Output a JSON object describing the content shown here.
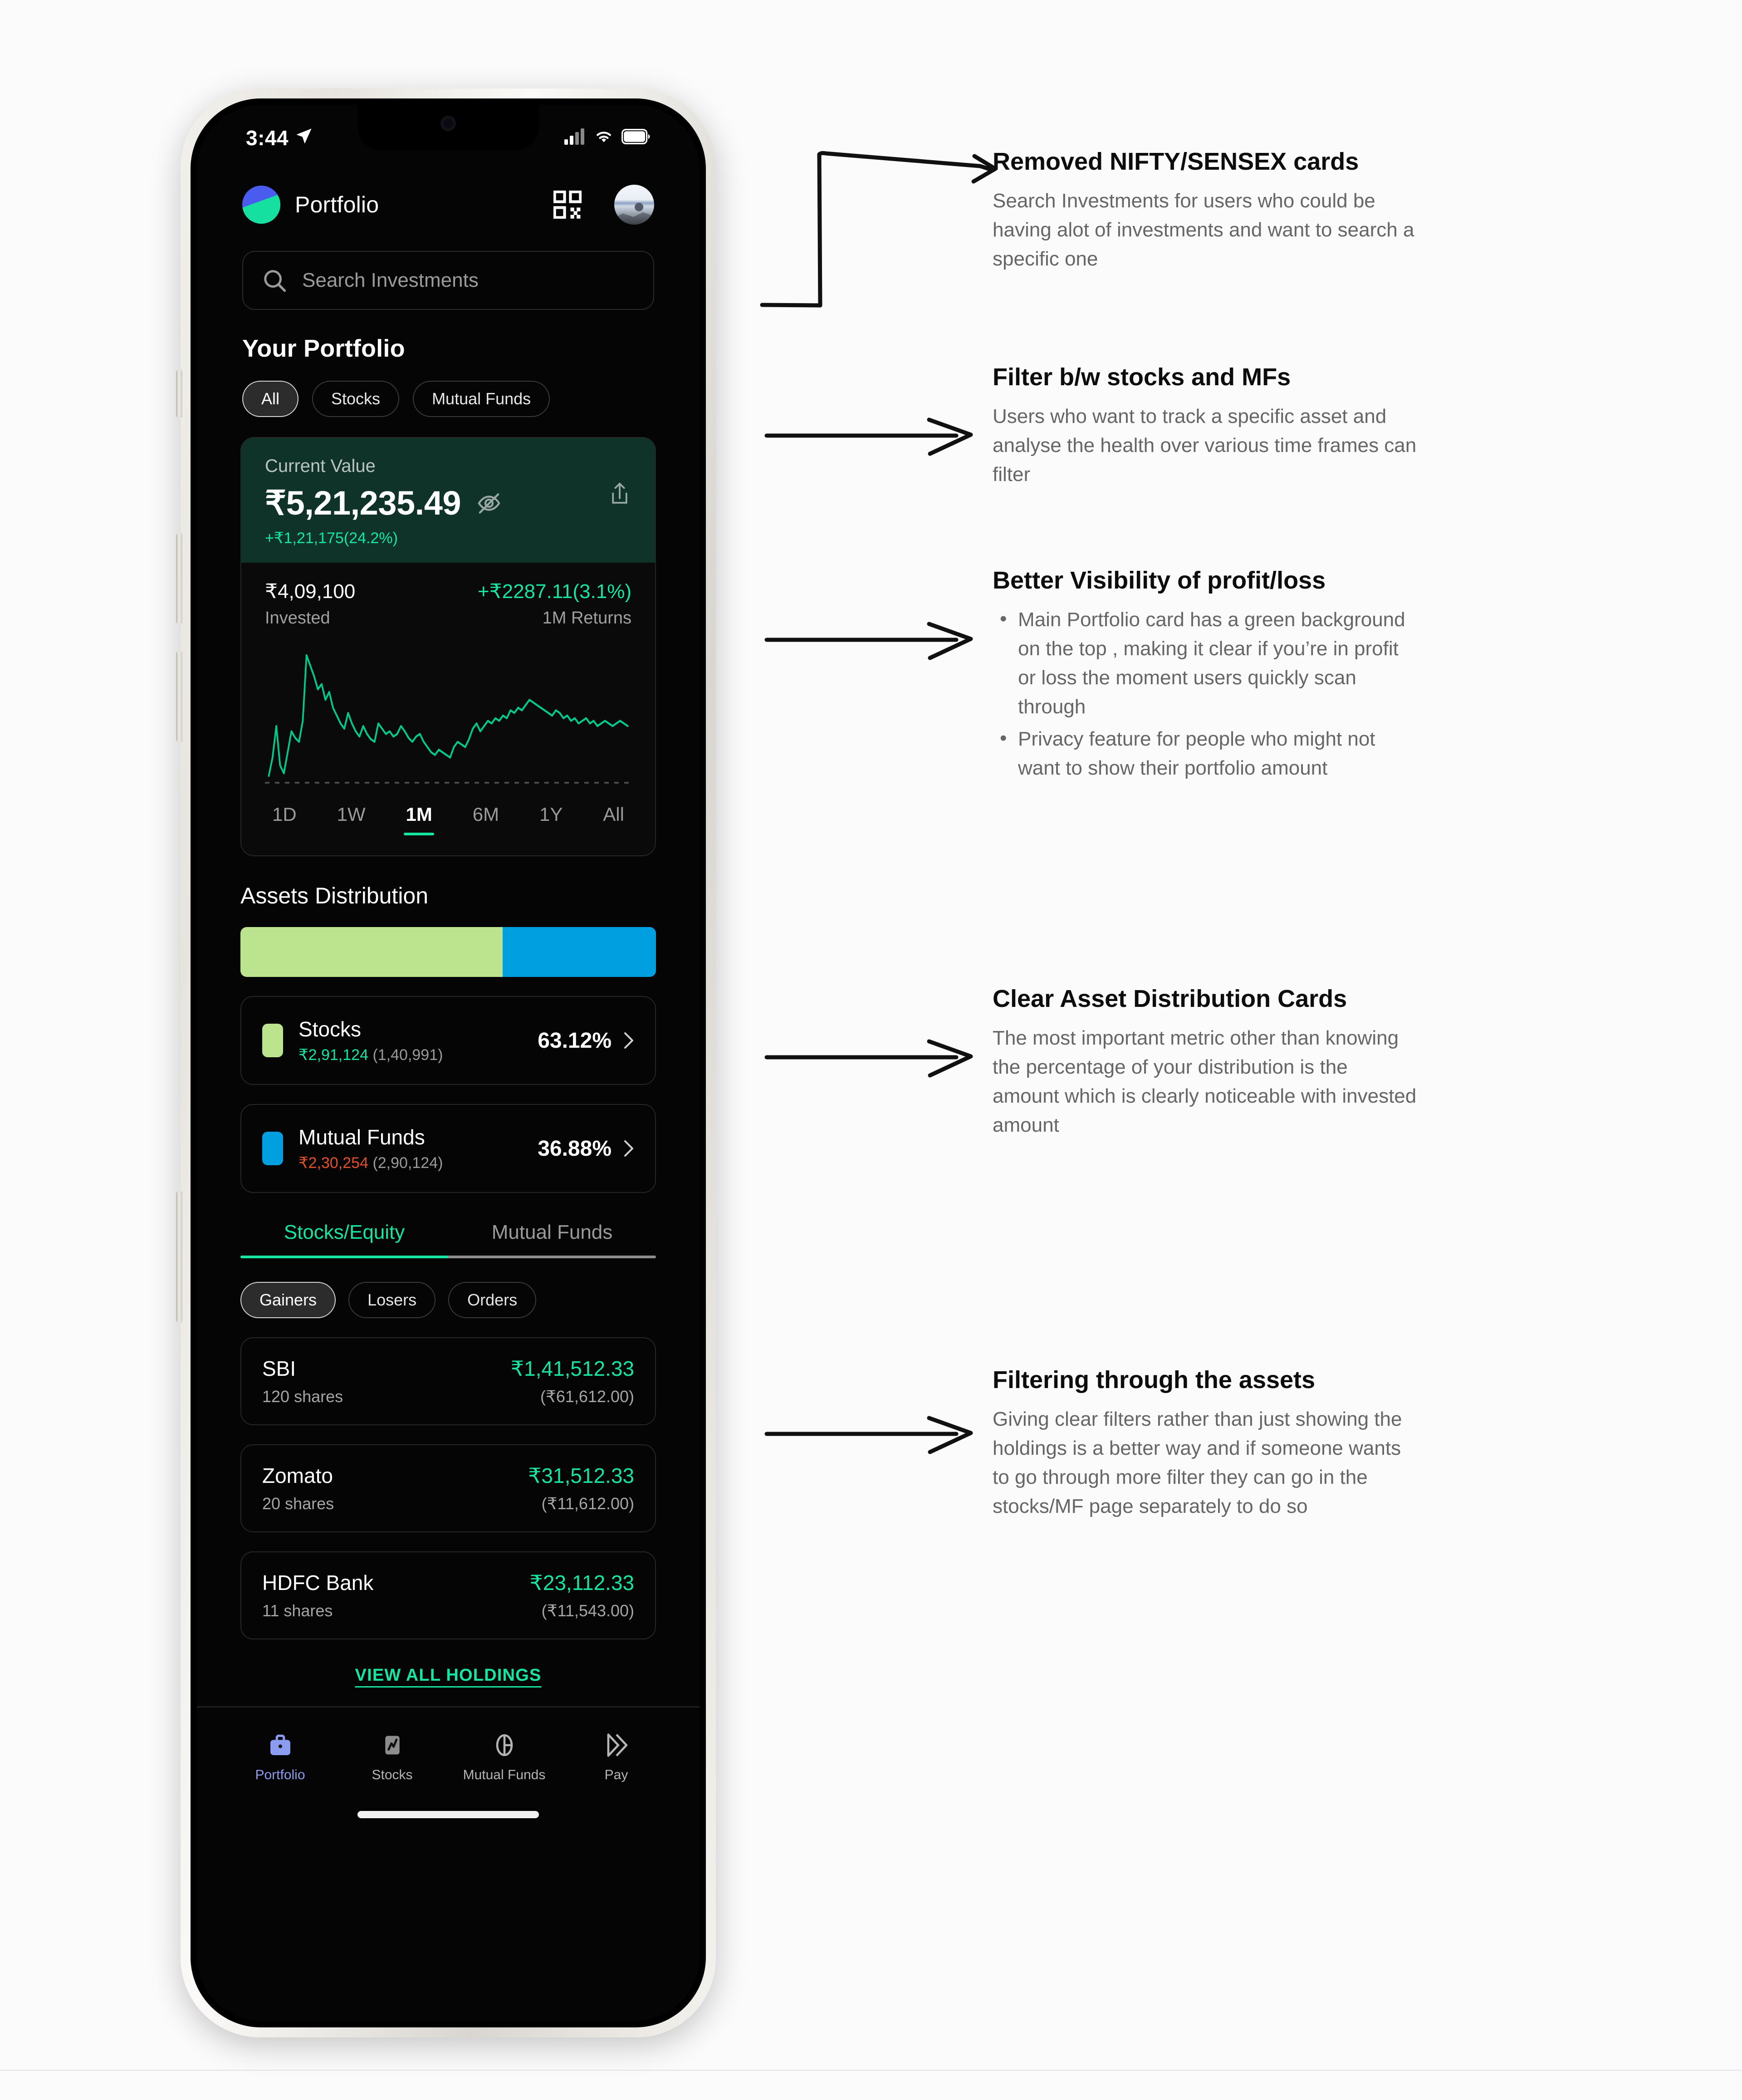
{
  "phone": {
    "status_bar": {
      "time": "3:44",
      "location_icon": "location-arrow-icon",
      "signal_icon": "cellular-signal-icon",
      "wifi_icon": "wifi-icon",
      "battery_icon": "battery-icon"
    },
    "header": {
      "title": "Portfolio",
      "logo_icon": "app-logo-icon",
      "qr_icon": "qr-code-icon",
      "avatar_icon": "user-avatar"
    },
    "search": {
      "placeholder": "Search Investments",
      "icon": "search-icon"
    },
    "section_title": "Your Portfolio",
    "filter_chips": [
      {
        "label": "All",
        "active": true
      },
      {
        "label": "Stocks",
        "active": false
      },
      {
        "label": "Mutual Funds",
        "active": false
      }
    ],
    "portfolio_card": {
      "current_value_label": "Current Value",
      "current_value": "₹5,21,235.49",
      "eye_icon": "eye-off-icon",
      "share_icon": "share-icon",
      "total_gain": "+₹1,21,175(24.2%)",
      "invested_value": "₹4,09,100",
      "invested_label": "Invested",
      "returns_value": "+₹2287.11(3.1%)",
      "returns_label": "1M Returns",
      "ranges": [
        {
          "label": "1D",
          "active": false
        },
        {
          "label": "1W",
          "active": false
        },
        {
          "label": "1M",
          "active": true
        },
        {
          "label": "6M",
          "active": false
        },
        {
          "label": "1Y",
          "active": false
        },
        {
          "label": "All",
          "active": false
        }
      ]
    },
    "assets_distribution": {
      "title": "Assets Distribution",
      "bar": [
        {
          "name": "Stocks",
          "percent": 63.12,
          "color": "#bce48f"
        },
        {
          "name": "Mutual Funds",
          "percent": 36.88,
          "color": "#00a0e0"
        }
      ],
      "cards": [
        {
          "name": "Stocks",
          "color": "#bce48f",
          "amount": "₹2,91,124",
          "amount_tone": "green",
          "invested": "(1,40,991)",
          "percent": "63.12%"
        },
        {
          "name": "Mutual Funds",
          "color": "#00a0e0",
          "amount": "₹2,30,254",
          "amount_tone": "red",
          "invested": "(2,90,124)",
          "percent": "36.88%"
        }
      ]
    },
    "holdings": {
      "tabs": [
        {
          "label": "Stocks/Equity",
          "active": true
        },
        {
          "label": "Mutual Funds",
          "active": false
        }
      ],
      "filter_chips": [
        {
          "label": "Gainers",
          "active": true
        },
        {
          "label": "Losers",
          "active": false
        },
        {
          "label": "Orders",
          "active": false
        }
      ],
      "items": [
        {
          "name": "SBI",
          "shares": "120 shares",
          "value": "₹1,41,512.33",
          "invested": "(₹61,612.00)"
        },
        {
          "name": "Zomato",
          "shares": "20 shares",
          "value": "₹31,512.33",
          "invested": "(₹11,612.00)"
        },
        {
          "name": "HDFC Bank",
          "shares": "11 shares",
          "value": "₹23,112.33",
          "invested": "(₹11,543.00)"
        }
      ],
      "view_all": "VIEW ALL HOLDINGS"
    },
    "tab_bar": [
      {
        "label": "Portfolio",
        "icon": "briefcase-icon",
        "active": true
      },
      {
        "label": "Stocks",
        "icon": "stock-chart-icon",
        "active": false
      },
      {
        "label": "Mutual Funds",
        "icon": "pie-chart-icon",
        "active": false
      },
      {
        "label": "Pay",
        "icon": "double-chevron-icon",
        "active": false
      }
    ]
  },
  "annotations": [
    {
      "title": "Removed NIFTY/SENSEX cards",
      "body": "Search Investments for users who could be having alot of investments and want to search a specific one"
    },
    {
      "title": "Filter b/w stocks and MFs",
      "body": "Users who want to track a specific asset and analyse the health over various time frames can filter"
    },
    {
      "title": "Better Visibility of profit/loss",
      "bullets": [
        "Main Portfolio card has a green background on the top , making it clear if you’re in profit or loss the moment users quickly scan through",
        "Privacy feature for people who might not want to show their portfolio amount"
      ]
    },
    {
      "title": "Clear Asset Distribution Cards",
      "body": "The most important metric other than knowing the percentage of your distribution is the amount which is clearly noticeable with invested amount"
    },
    {
      "title": "Filtering through the assets",
      "body": "Giving clear filters rather than just showing the holdings is a better way and if someone wants to go through more filter they can go in the stocks/MF page separately to do so"
    }
  ],
  "chart_data": {
    "type": "line",
    "title": "1M Portfolio Value Sparkline",
    "xlabel": "",
    "ylabel": "",
    "grid": false,
    "legend": "none",
    "color": "#00c98d",
    "x": [
      0,
      1,
      2,
      3,
      4,
      5,
      6,
      7,
      8,
      9,
      10,
      11,
      12,
      13,
      14,
      15,
      16,
      17,
      18,
      19,
      20,
      21,
      22,
      23,
      24,
      25,
      26,
      27,
      28,
      29,
      30,
      31,
      32,
      33,
      34,
      35,
      36,
      37,
      38,
      39,
      40,
      41,
      42,
      43,
      44,
      45,
      46,
      47,
      48,
      49,
      50,
      51,
      52,
      53,
      54,
      55,
      56,
      57,
      58,
      59,
      60,
      61,
      62,
      63,
      64,
      65,
      66,
      67,
      68,
      69,
      70,
      71,
      72,
      73,
      74,
      75,
      76,
      77,
      78,
      79,
      80,
      81,
      82,
      83,
      84,
      85,
      86,
      87,
      88,
      89,
      90,
      91,
      92,
      93,
      94,
      95
    ],
    "values": [
      4,
      18,
      42,
      12,
      6,
      22,
      38,
      33,
      30,
      46,
      96,
      88,
      80,
      70,
      74,
      62,
      68,
      56,
      50,
      44,
      40,
      52,
      44,
      38,
      34,
      42,
      36,
      32,
      30,
      44,
      40,
      36,
      38,
      34,
      36,
      42,
      38,
      33,
      30,
      34,
      36,
      30,
      26,
      22,
      20,
      24,
      22,
      20,
      18,
      26,
      30,
      28,
      26,
      32,
      40,
      44,
      38,
      42,
      46,
      44,
      48,
      46,
      50,
      48,
      54,
      52,
      56,
      54,
      58,
      62,
      60,
      58,
      56,
      54,
      52,
      50,
      54,
      52,
      48,
      50,
      46,
      48,
      44,
      46,
      48,
      44,
      46,
      42,
      44,
      46,
      44,
      42,
      44,
      46,
      44,
      42
    ]
  }
}
